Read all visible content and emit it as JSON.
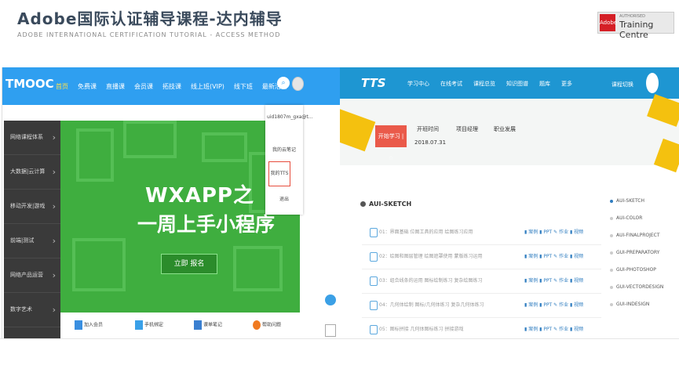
{
  "slide": {
    "title": "Adobe国际认证辅导课程-达内辅导",
    "subtitle": "ADOBE INTERNATIONAL   CERTIFICATION  TUTORIAL  - ACCESS METHOD",
    "badge": {
      "mark": "Adobe",
      "auth": "AUTHORISED",
      "text": "Training Centre"
    }
  },
  "left": {
    "brand": "TMOOC",
    "nav": [
      "首页",
      "免费课",
      "直播课",
      "会员课",
      "拓技课",
      "线上班(VIP)",
      "线下班",
      "最新活动"
    ],
    "sidebar": [
      "网络课程体系",
      "大数据|云计算",
      "移动开发|游戏",
      "前端|测试",
      "网络产品运营",
      "数字艺术"
    ],
    "banner": {
      "line1": "WXAPP之",
      "line2": "一周上手小程序",
      "button": "立即 报名"
    },
    "dropdown": {
      "user": "uid1807m_gxa@t...",
      "notes": "我的云笔记",
      "tts": "我的TTS",
      "exit": "退出"
    },
    "bottom": [
      "加入会员",
      "手机绑定",
      "课单笔记",
      "帮助问题"
    ]
  },
  "right": {
    "brand": "TTS",
    "nav": [
      "学习中心",
      "在线考试",
      "课程总览",
      "知识图谱",
      "题库",
      "更多"
    ],
    "user_action": "课程切换",
    "hero": {
      "button": "开始学习 | ☆",
      "start": "开班时间",
      "date": "2018.07.31",
      "project": "项目经理",
      "career": "职业发展"
    },
    "section": "AUI-SKETCH",
    "rows": [
      {
        "text": "01：界面基础 位图工具的应用 绘图练习应用",
        "acts": "▮ 案例  ▮ PPT  ✎ 作业  ▮ 视频"
      },
      {
        "text": "02：绘图和图层管理 绘图遮罩使用 蒙版练习运用",
        "acts": "▮ 案例  ▮ PPT  ✎ 作业  ▮ 视频"
      },
      {
        "text": "03：组合线条的运用 图标绘制练习 复杂绘图练习",
        "acts": "▮ 案例  ▮ PPT  ✎ 作业  ▮ 视频"
      },
      {
        "text": "04：几何体绘制 图标/几何体练习 复杂几何体练习",
        "acts": "▮ 案例  ▮ PPT  ✎ 作业  ▮ 视频"
      },
      {
        "text": "05：图标拼接 几何体图标练习 拼接游戏",
        "acts": "▮ 案例  ▮ PPT  ✎ 作业  ▮ 视频"
      }
    ],
    "course_list": [
      "AUI-SKETCH",
      "AUI-COLOR",
      "AUI-FINALPROJECT",
      "GUI-PREPARATORY",
      "GUI-PHOTOSHOP",
      "GUI-VECTORDESIGN",
      "GUI-INDESIGN"
    ]
  }
}
